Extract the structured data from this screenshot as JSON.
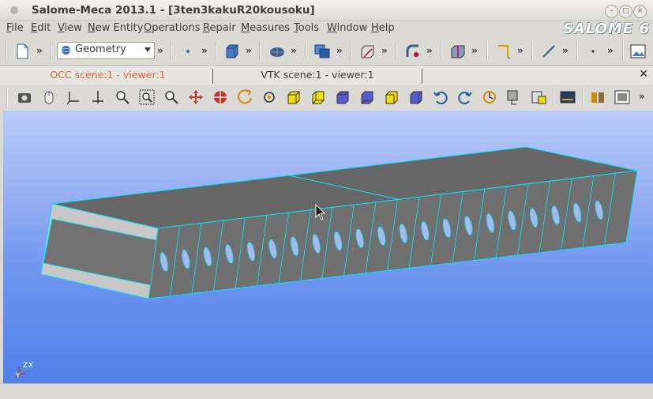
{
  "window": {
    "title": "Salome-Meca 2013.1 - [3ten3kakuR20kousoku]",
    "minimize": "–",
    "maximize": "□",
    "close": "×"
  },
  "brand": "SALOME 6",
  "menu": [
    {
      "label": "File",
      "accel": "F",
      "rest": "ile"
    },
    {
      "label": "Edit",
      "accel": "E",
      "rest": "dit"
    },
    {
      "label": "View",
      "accel": "V",
      "rest": "iew"
    },
    {
      "label": "New Entity",
      "accel": "N",
      "rest": "ew Entity"
    },
    {
      "label": "Operations",
      "accel": "O",
      "rest": "perations"
    },
    {
      "label": "Repair",
      "accel": "R",
      "rest": "epair"
    },
    {
      "label": "Measures",
      "accel": "M",
      "rest": "easures"
    },
    {
      "label": "Tools",
      "accel": "T",
      "rest": "ools"
    },
    {
      "label": "Window",
      "accel": "W",
      "rest": "indow"
    },
    {
      "label": "Help",
      "accel": "H",
      "rest": "elp"
    }
  ],
  "module_selector": {
    "value": "Geometry"
  },
  "tabs": [
    {
      "label": "OCC scene:1 - viewer:1",
      "active": true
    },
    {
      "label": "VTK scene:1 - viewer:1",
      "active": false
    }
  ],
  "overflow_glyph": "»",
  "axes": {
    "z": "Z",
    "x": "X",
    "y": "Y"
  },
  "colors": {
    "accent_tab": "#e0633a",
    "edge": "#00e5ff",
    "face": "#666666",
    "background_top": "#b9cbf8",
    "background_bottom": "#4f81ea"
  }
}
